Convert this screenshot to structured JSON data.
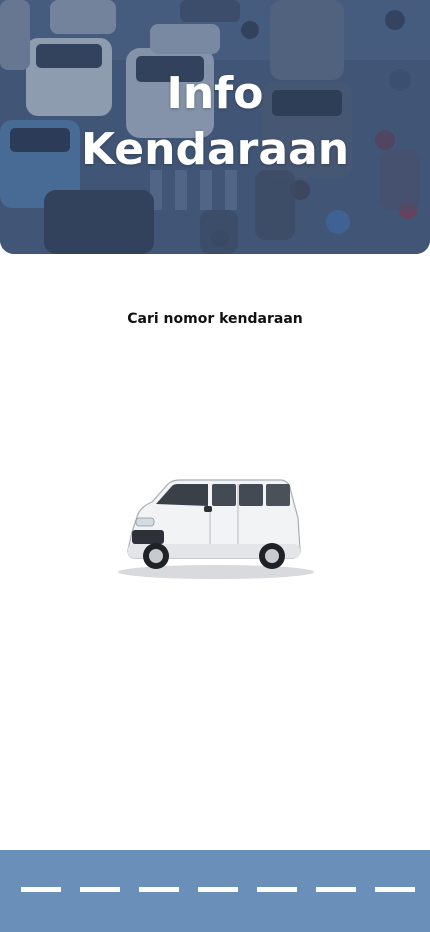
{
  "header": {
    "title_line1": "Info",
    "title_line2": "Kendaraan",
    "overlay_color": "#3e5272"
  },
  "search": {
    "label": "Cari nomor kendaraan"
  },
  "illustration": {
    "subject": "white-minivan"
  },
  "footer": {
    "road_color": "#6a8fb8",
    "lane_marking_color": "#ffffff"
  }
}
